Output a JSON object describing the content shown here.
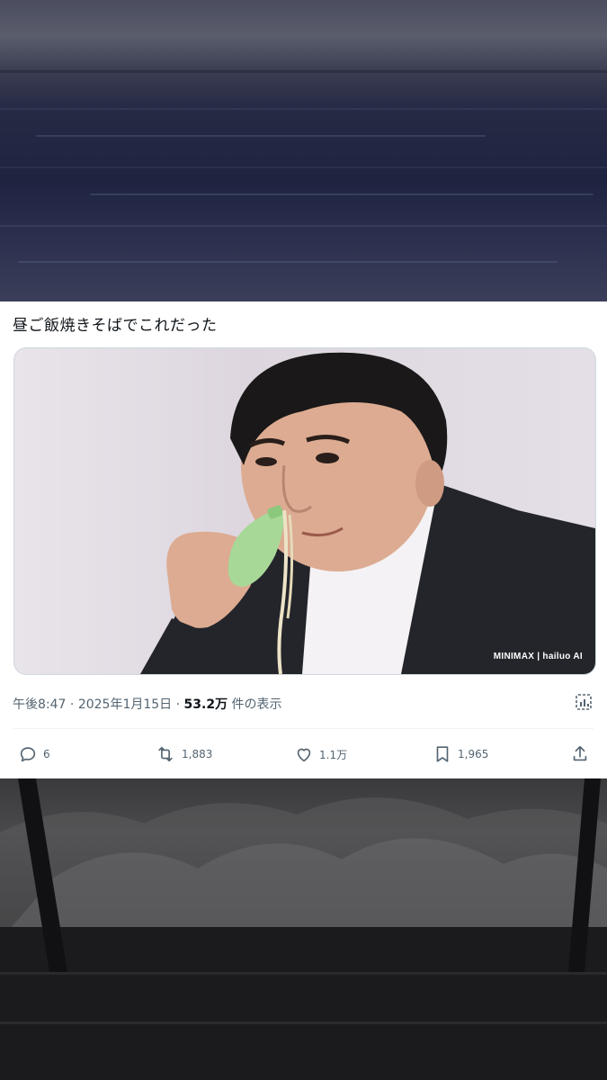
{
  "tweet": {
    "text": "昼ご飯焼きそばでこれだった",
    "media_watermark": "MINIMAX | hailuo AI",
    "time": "午後8:47",
    "sep1": " · ",
    "date": "2025年1月15日",
    "sep2": " · ",
    "views_count": "53.2万",
    "views_label": " 件の表示"
  },
  "actions": {
    "replies": "6",
    "reposts": "1,883",
    "likes": "1.1万",
    "bookmarks": "1,965"
  },
  "icons": {
    "reply": "reply-icon",
    "repost": "repost-icon",
    "like": "heart-icon",
    "bookmark": "bookmark-icon",
    "share": "share-icon",
    "analytics": "analytics-icon"
  },
  "colors": {
    "text_primary": "#0f1419",
    "text_secondary": "#536471",
    "card_bg": "#ffffff"
  }
}
